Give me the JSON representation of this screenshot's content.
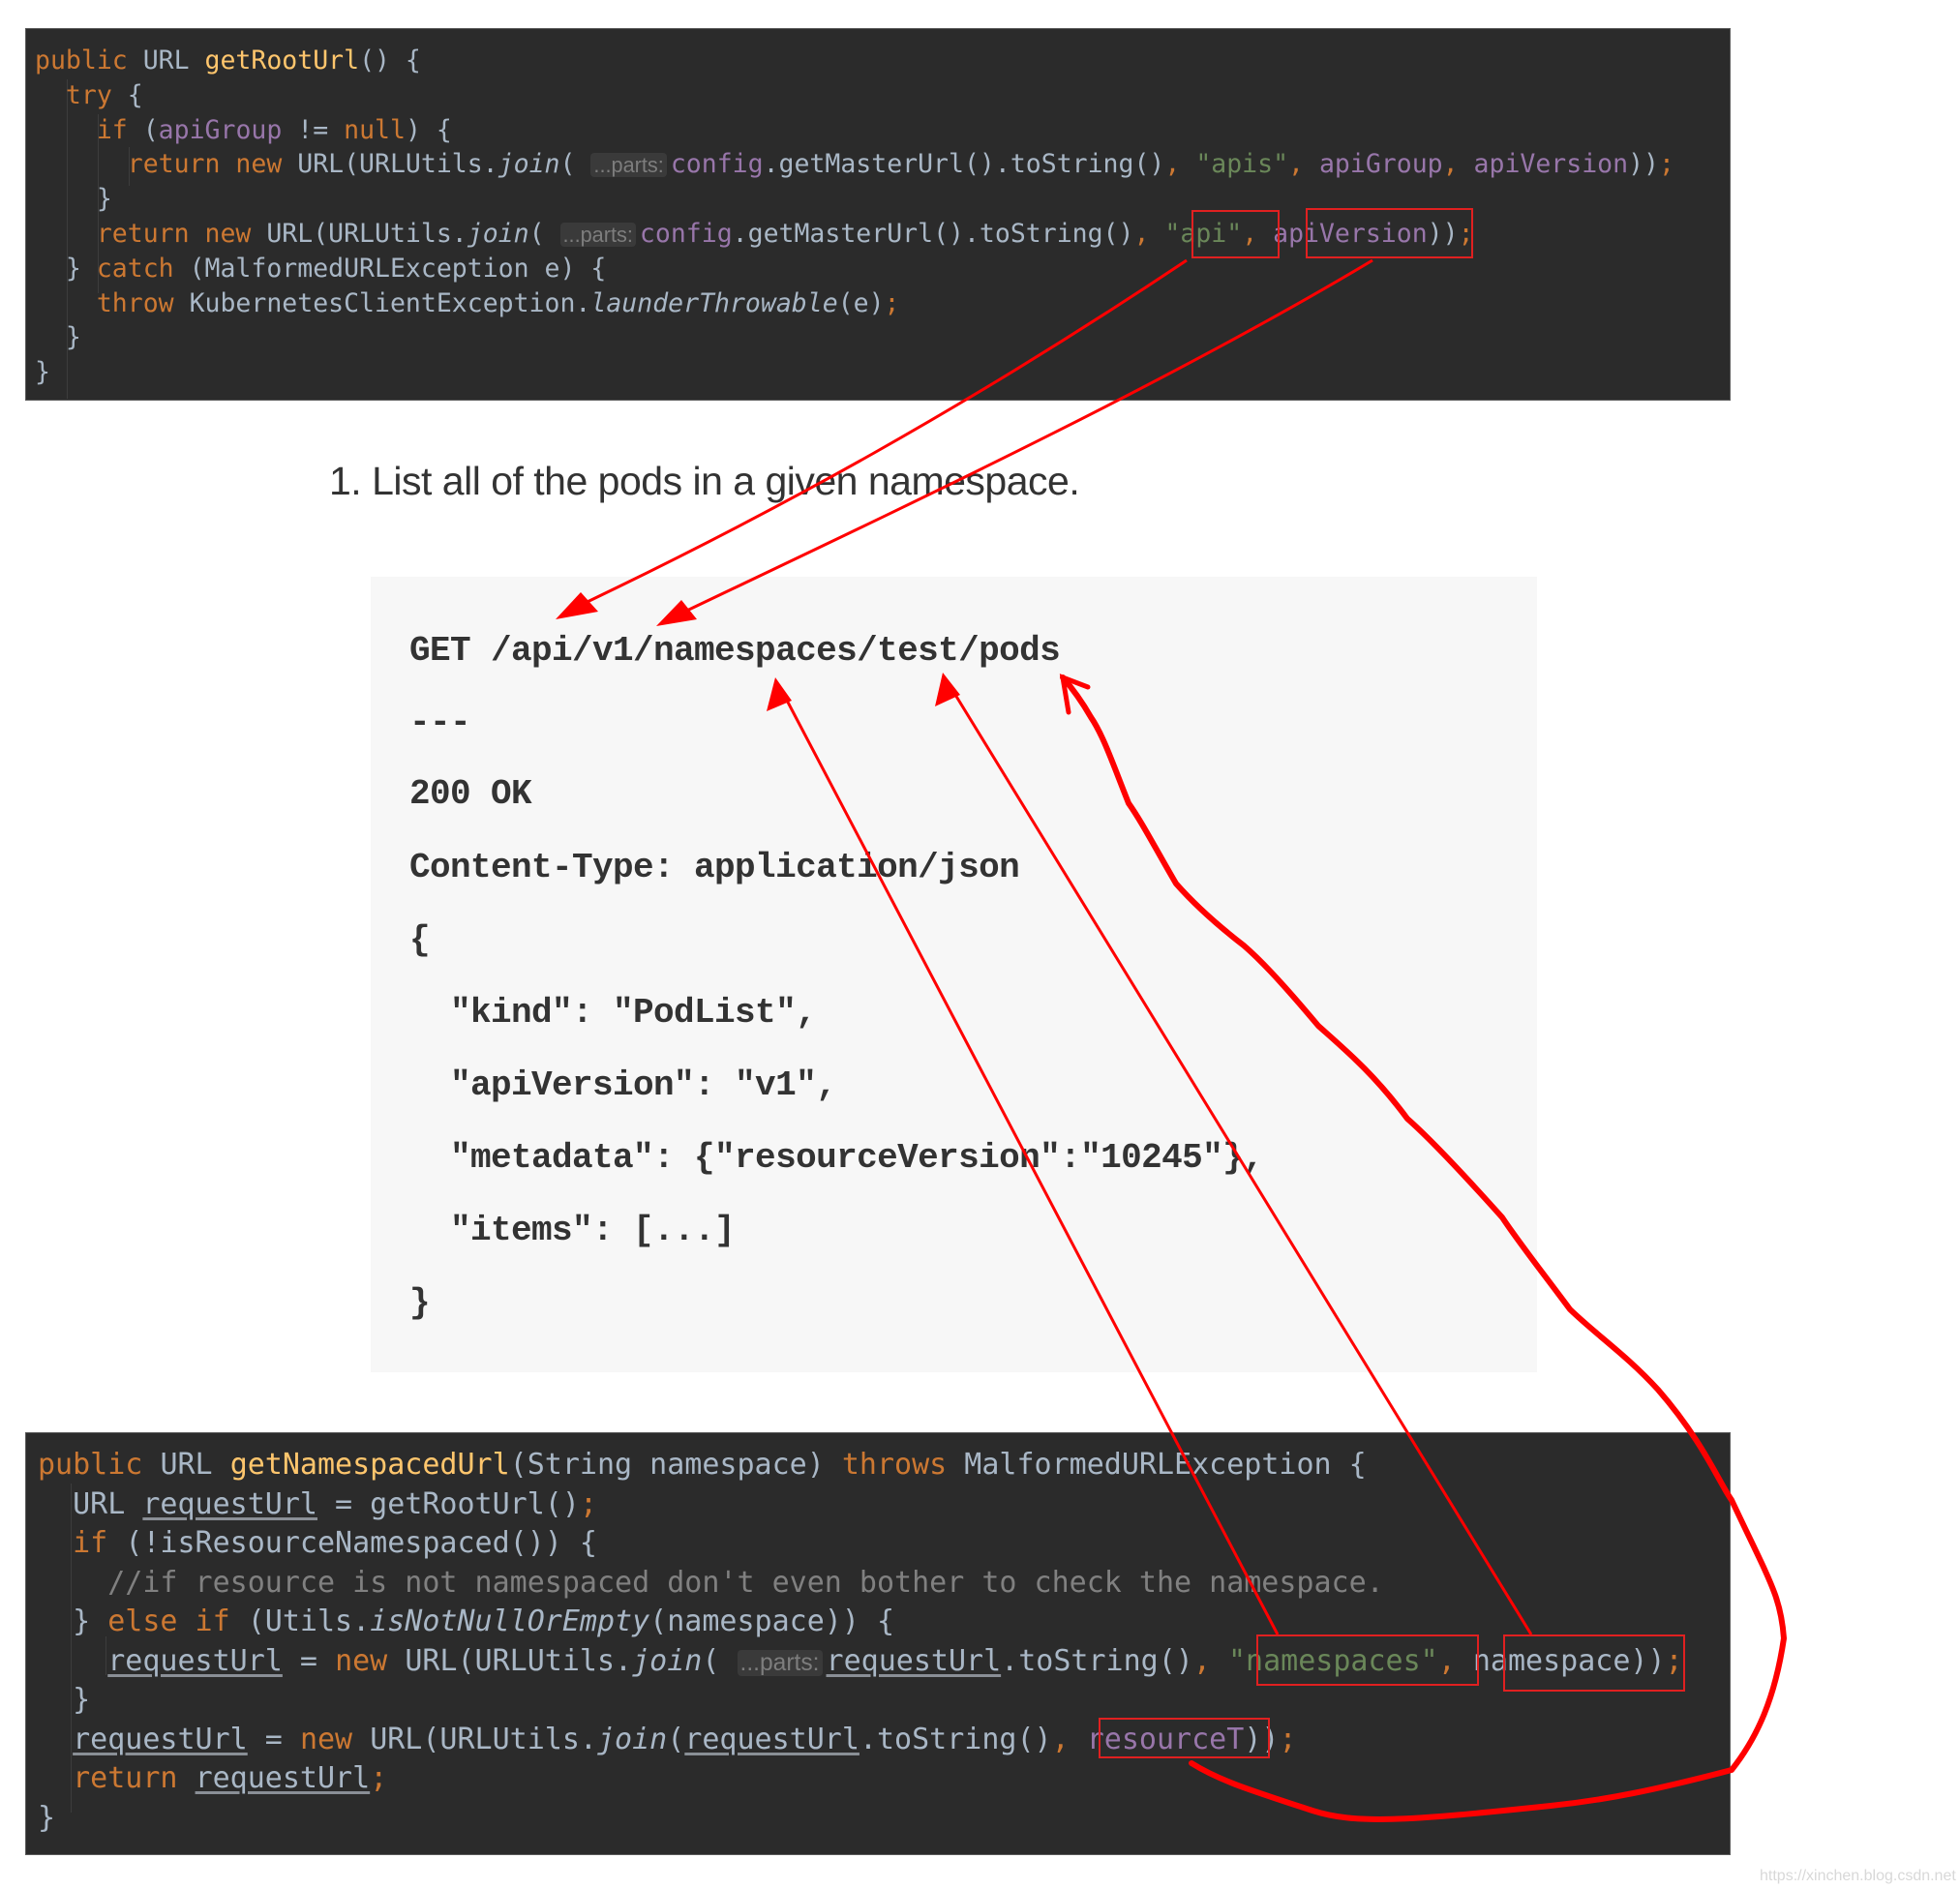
{
  "top_code": {
    "lines": [
      [
        [
          "kw",
          "public "
        ],
        [
          "",
          "URL "
        ],
        [
          "fn",
          "getRootUrl"
        ],
        [
          "",
          "() {"
        ]
      ],
      [
        [
          "",
          "  "
        ],
        [
          "kw",
          "try "
        ],
        [
          "",
          "{"
        ]
      ],
      [
        [
          "",
          "    "
        ],
        [
          "kw",
          "if "
        ],
        [
          "",
          "("
        ],
        [
          "fld",
          "apiGroup"
        ],
        [
          "",
          " != "
        ],
        [
          "kw",
          "null"
        ],
        [
          "",
          ") {"
        ]
      ],
      [
        [
          "",
          "      "
        ],
        [
          "kw",
          "return new "
        ],
        [
          "",
          "URL(URLUtils."
        ],
        [
          "it",
          "join"
        ],
        [
          "",
          "( "
        ],
        [
          "hint",
          "...parts:"
        ],
        [
          "fld",
          "config"
        ],
        [
          "",
          ".getMasterUrl().toString()"
        ],
        [
          "kw",
          ", "
        ],
        [
          "str",
          "\"apis\""
        ],
        [
          "kw",
          ", "
        ],
        [
          "fld",
          "apiGroup"
        ],
        [
          "kw",
          ", "
        ],
        [
          "fld",
          "apiVersion"
        ],
        [
          "",
          "))"
        ],
        [
          "kw",
          ";"
        ]
      ],
      [
        [
          "",
          "    }"
        ]
      ],
      [
        [
          "",
          "    "
        ],
        [
          "kw",
          "return new "
        ],
        [
          "",
          "URL(URLUtils."
        ],
        [
          "it",
          "join"
        ],
        [
          "",
          "( "
        ],
        [
          "hint",
          "...parts:"
        ],
        [
          "fld",
          "config"
        ],
        [
          "",
          ".getMasterUrl().toString()"
        ],
        [
          "kw",
          ", "
        ],
        [
          "str",
          "\"api\""
        ],
        [
          "kw",
          ", "
        ],
        [
          "fld",
          "apiVersion"
        ],
        [
          "",
          "))"
        ],
        [
          "kw",
          ";"
        ]
      ],
      [
        [
          "",
          "  } "
        ],
        [
          "kw",
          "catch "
        ],
        [
          "",
          "(MalformedURLException e) {"
        ]
      ],
      [
        [
          "",
          "    "
        ],
        [
          "kw",
          "throw "
        ],
        [
          "",
          "KubernetesClientException."
        ],
        [
          "it",
          "launderThrowable"
        ],
        [
          "",
          "(e)"
        ],
        [
          "kw",
          ";"
        ]
      ],
      [
        [
          "",
          "  }"
        ]
      ],
      [
        [
          "",
          "}"
        ]
      ]
    ],
    "highlights": [
      "\"api\"",
      "apiVersion"
    ]
  },
  "doc": {
    "heading": "1. List all of the pods in a given namespace.",
    "lines": [
      "GET /api/v1/namespaces/test/pods",
      "---",
      "200 OK",
      "Content-Type: application/json",
      "{",
      "  \"kind\": \"PodList\",",
      "  \"apiVersion\": \"v1\",",
      "  \"metadata\": {\"resourceVersion\":\"10245\"},",
      "  \"items\": [...]",
      "}"
    ]
  },
  "bottom_code": {
    "lines": [
      [
        [
          "kw",
          "public "
        ],
        [
          "",
          "URL "
        ],
        [
          "fn",
          "getNamespacedUrl"
        ],
        [
          "",
          "(String namespace) "
        ],
        [
          "kw",
          "throws "
        ],
        [
          "",
          "MalformedURLException {"
        ]
      ],
      [
        [
          "",
          "  URL "
        ],
        [
          "ul",
          "requestUrl"
        ],
        [
          "",
          " = getRootUrl()"
        ],
        [
          "kw",
          ";"
        ]
      ],
      [
        [
          "",
          "  "
        ],
        [
          "kw",
          "if "
        ],
        [
          "",
          "(!isResourceNamespaced()) {"
        ]
      ],
      [
        [
          "",
          "    "
        ],
        [
          "cmt",
          "//if resource is not namespaced don't even bother to check the namespace."
        ]
      ],
      [
        [
          "",
          "  } "
        ],
        [
          "kw",
          "else if "
        ],
        [
          "",
          "(Utils."
        ],
        [
          "it",
          "isNotNullOrEmpty"
        ],
        [
          "",
          "(namespace)) {"
        ]
      ],
      [
        [
          "",
          "    "
        ],
        [
          "ul",
          "requestUrl"
        ],
        [
          "",
          " = "
        ],
        [
          "kw",
          "new "
        ],
        [
          "",
          "URL(URLUtils."
        ],
        [
          "it",
          "join"
        ],
        [
          "",
          "( "
        ],
        [
          "hint",
          "...parts:"
        ],
        [
          "ul",
          "requestUrl"
        ],
        [
          "",
          ".toString()"
        ],
        [
          "kw",
          ", "
        ],
        [
          "str",
          "\"namespaces\""
        ],
        [
          "kw",
          ", "
        ],
        [
          "",
          "namespace))"
        ],
        [
          "kw",
          ";"
        ]
      ],
      [
        [
          "",
          "  }"
        ]
      ],
      [
        [
          "",
          "  "
        ],
        [
          "ul",
          "requestUrl"
        ],
        [
          "",
          " = "
        ],
        [
          "kw",
          "new "
        ],
        [
          "",
          "URL(URLUtils."
        ],
        [
          "it",
          "join"
        ],
        [
          "",
          "("
        ],
        [
          "ul",
          "requestUrl"
        ],
        [
          "",
          ".toString()"
        ],
        [
          "kw",
          ", "
        ],
        [
          "fld",
          "resourceT"
        ],
        [
          "",
          "))"
        ],
        [
          "kw",
          ";"
        ]
      ],
      [
        [
          "",
          "  "
        ],
        [
          "kw",
          "return "
        ],
        [
          "ul",
          "requestUrl"
        ],
        [
          "kw",
          ";"
        ]
      ],
      [
        [
          "",
          "}"
        ]
      ]
    ],
    "highlights": [
      "\"namespaces\"",
      "namespace",
      "resourceT"
    ]
  },
  "annotations": {
    "color": "#ff0000",
    "arrows": [
      {
        "from": "\"api\" (getRootUrl)",
        "to": "/api"
      },
      {
        "from": "apiVersion (getRootUrl)",
        "to": "/v1"
      },
      {
        "from": "\"namespaces\" (getNamespacedUrl)",
        "to": "/namespaces"
      },
      {
        "from": "namespace (getNamespacedUrl)",
        "to": "/test"
      },
      {
        "from": "resourceT (getNamespacedUrl)",
        "to": "/pods"
      }
    ]
  },
  "watermark": "https://xinchen.blog.csdn.net"
}
